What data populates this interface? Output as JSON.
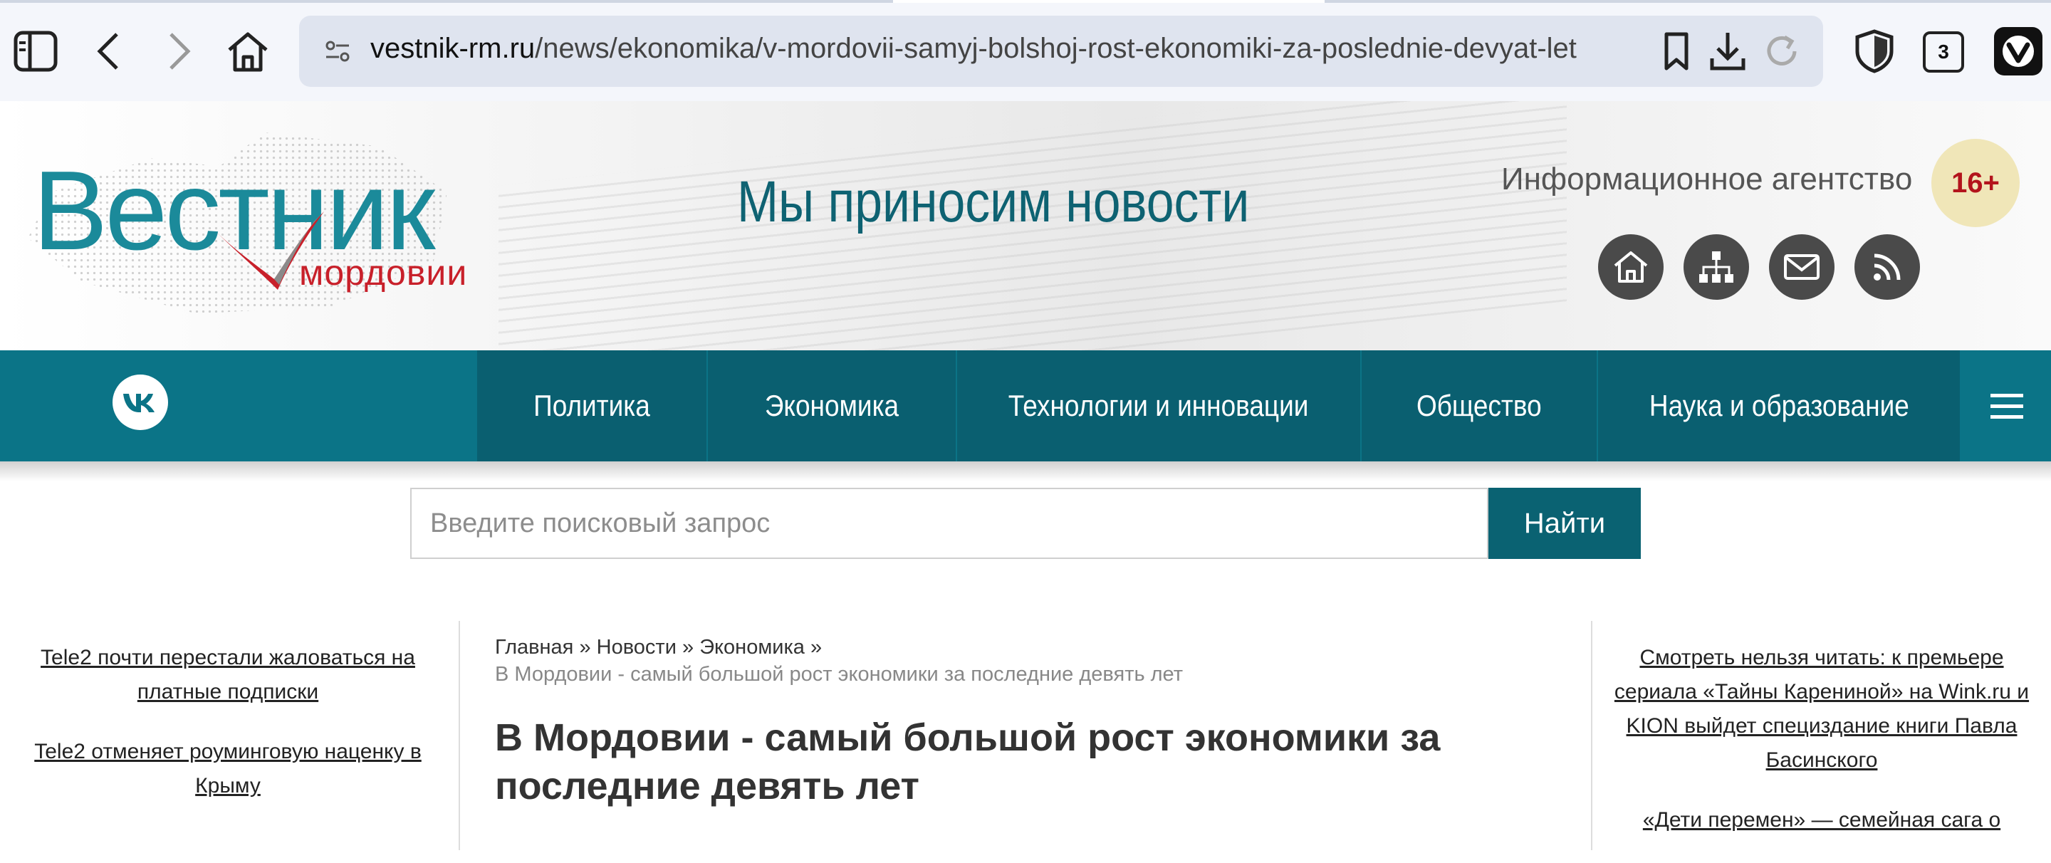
{
  "browser": {
    "url_domain": "vestnik-rm.ru",
    "url_path": "/news/ekonomika/v-mordovii-samyj-bolshoj-rost-ekonomiki-za-poslednie-devyat-let",
    "tab_count": "3",
    "icons": [
      "sidebar-icon",
      "back-icon",
      "forward-icon",
      "home-icon",
      "site-settings-icon",
      "bookmark-icon",
      "download-icon",
      "reload-icon",
      "shield-icon",
      "vivaldi-icon"
    ]
  },
  "header": {
    "logo_main": "Вестник",
    "logo_sub": "мордовии",
    "tagline": "Мы приносим новости",
    "agency": "Информационное агентство",
    "age_rating": "16+",
    "icons": [
      "home-icon",
      "sitemap-icon",
      "mail-icon",
      "rss-icon"
    ]
  },
  "nav": {
    "social": "vk",
    "items": [
      {
        "label": "Политика"
      },
      {
        "label": "Экономика"
      },
      {
        "label": "Технологии и инновации"
      },
      {
        "label": "Общество"
      },
      {
        "label": "Наука и образование"
      }
    ]
  },
  "search": {
    "placeholder": "Введите поисковый запрос",
    "button": "Найти"
  },
  "left_links": [
    "Tele2 почти перестали жаловаться на платные подписки",
    "Tele2 отменяет роуминговую наценку в Крыму"
  ],
  "breadcrumb": {
    "home": "Главная",
    "news": "Новости",
    "section": "Экономика",
    "sep": "»",
    "current": "В Мордовии - самый большой рост экономики за последние девять лет"
  },
  "article": {
    "title": "В Мордовии - самый большой рост экономики за последние девять лет"
  },
  "right_links": [
    "Смотреть нельзя читать: к премьере сериала «Тайны Карениной» на Wink.ru и KION выйдет специздание книги Павла Басинского",
    "«Дети перемен» — семейная сага о"
  ]
}
